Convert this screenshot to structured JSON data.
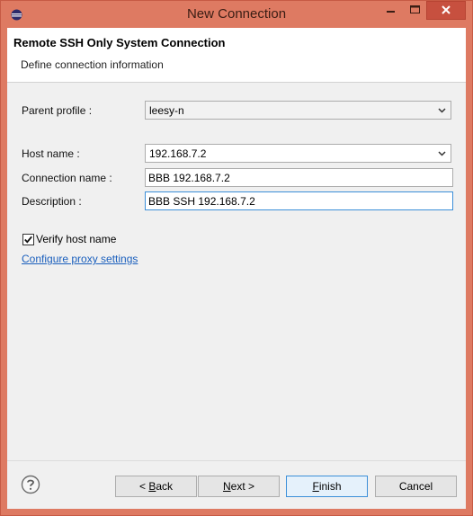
{
  "window": {
    "title": "New Connection",
    "accent_color": "#de7a62",
    "close_color": "#c7503f"
  },
  "banner": {
    "title": "Remote SSH Only System Connection",
    "description": "Define connection information"
  },
  "form": {
    "parent_profile": {
      "label": "Parent profile :",
      "value": "leesy-n"
    },
    "host_name": {
      "label": "Host name :",
      "value": "192.168.7.2"
    },
    "connection_name": {
      "label": "Connection name :",
      "value": "BBB 192.168.7.2"
    },
    "description": {
      "label": "Description :",
      "value": "BBB SSH 192.168.7.2"
    },
    "verify_host": {
      "label": "Verify host name",
      "checked": true
    },
    "proxy_link": "Configure proxy settings"
  },
  "buttons": {
    "back_prefix": "< ",
    "back_mnemonic": "B",
    "back_rest": "ack",
    "next_mnemonic": "N",
    "next_rest": "ext >",
    "finish_mnemonic": "F",
    "finish_rest": "inish",
    "cancel": "Cancel"
  },
  "icons": {
    "app": "eclipse-icon",
    "help": "help-question-icon",
    "minimize": "minimize-icon",
    "maximize": "maximize-icon",
    "close": "close-icon",
    "dropdown": "chevron-down-icon",
    "check": "checkmark-icon"
  }
}
